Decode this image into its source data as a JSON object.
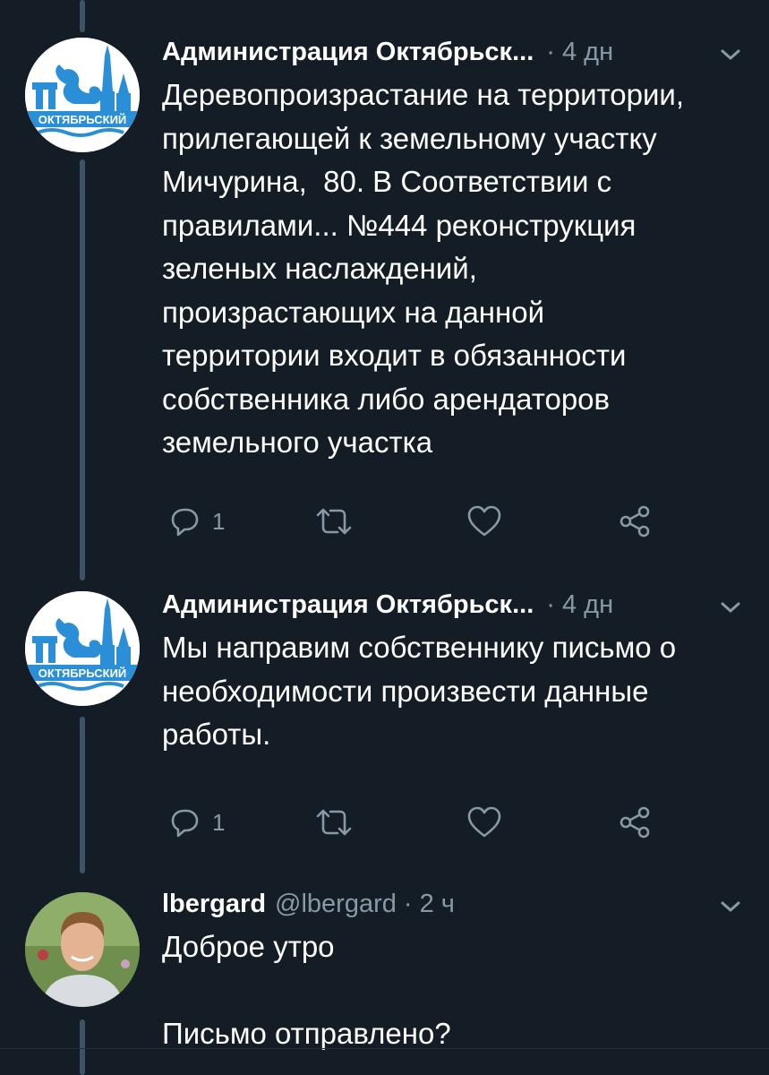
{
  "tweets": [
    {
      "author": "Администрация Октябрьск...",
      "meta": "· 4 дн",
      "avatar_label": "ОКТЯБРЬСКИЙ",
      "text": "Деревопроизрастание на территории,\nприлегающей к земельному участку\nМичурина,  80. В Соответствии с\nправилами... №444 реконструкция\nзеленых наслаждений,\nпроизрастающих на данной\nтерритории входит в обязанности\nсобственника либо арендаторов\nземельного участка",
      "reply_count": "1"
    },
    {
      "author": "Администрация Октябрьск...",
      "meta": "· 4 дн",
      "avatar_label": "ОКТЯБРЬСКИЙ",
      "text": "Мы направим собственнику письмо о\nнеобходимости произвести данные\nработы.",
      "reply_count": "1"
    },
    {
      "author": "lbergard",
      "handle": "@lbergard",
      "meta": "· 2 ч",
      "text": "Доброе утро\n\nПисьмо отправлено?"
    }
  ],
  "colors": {
    "background": "#141d26",
    "secondary_text": "#8899a6",
    "thread_line": "#3d5466",
    "logo_blue": "#2a8fd6"
  },
  "icons": [
    "reply-icon",
    "retweet-icon",
    "like-icon",
    "share-icon",
    "chevron-down-icon"
  ]
}
